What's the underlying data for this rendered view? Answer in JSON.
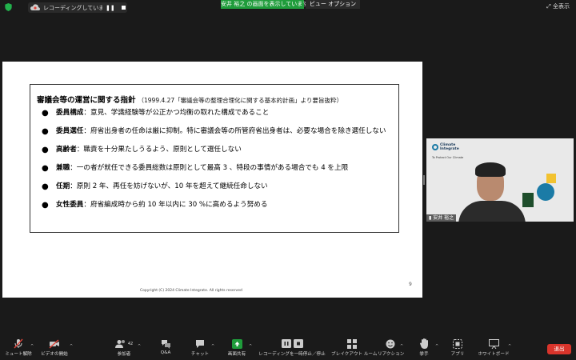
{
  "topbar": {
    "recording_text": "レコーディングしています...",
    "share_banner": "安井 裕之 の画面を表示しています",
    "view_options": "ビュー オプション",
    "fullscreen": "全表示"
  },
  "slide": {
    "heading": "審議会等の運営に関する指針",
    "heading_note": "（1999.4.27「審議会等の整理合理化に関する基本的計画」より要旨抜粋）",
    "items": [
      {
        "term": "委員構成",
        "text": "：意見、学識経験等が公正かつ均衡の取れた構成であること"
      },
      {
        "term": "委員選任",
        "text": "：府省出身者の任命は厳に抑制。特に審議会等の所管府省出身者は、必要な場合を除き選任しない"
      },
      {
        "term": "高齢者",
        "text": "：職責を十分果たしうるよう、原則として選任しない"
      },
      {
        "term": "兼職",
        "text": "：一の者が就任できる委員総数は原則として最高 3 、特段の事情がある場合でも 4 を上限"
      },
      {
        "term": "任期",
        "text": "：原則 2 年、再任を妨げないが、10 年を超えて継続任命しない"
      },
      {
        "term": "女性委員",
        "text": "：府省編成時から約 10 年以内に 30 %に高めるよう努める"
      }
    ],
    "copyright": "Copyright (C) 2024 Climate Integrate. All rights reserved",
    "page_number": "9"
  },
  "video": {
    "logo_text": "Climate\nIntegrate",
    "tagline": "To Protect Our Climate",
    "participant_name": "安井 裕之"
  },
  "toolbar": {
    "mute": "ミュート解除",
    "video": "ビデオの開始",
    "participants": "参加者",
    "participants_count": "42",
    "qa": "Q&A",
    "chat": "チャット",
    "share": "画面共有",
    "recording": "レコーディングを一時停止／停止",
    "breakout": "ブレイクアウト ルーム",
    "reactions": "リアクション",
    "raise_hand": "挙手",
    "apps": "アプリ",
    "whiteboard": "ホワイトボード",
    "end": "退出"
  },
  "colors": {
    "share_green": "#1f9c3b",
    "end_red": "#d9342b",
    "mute_red": "#e0453a"
  }
}
